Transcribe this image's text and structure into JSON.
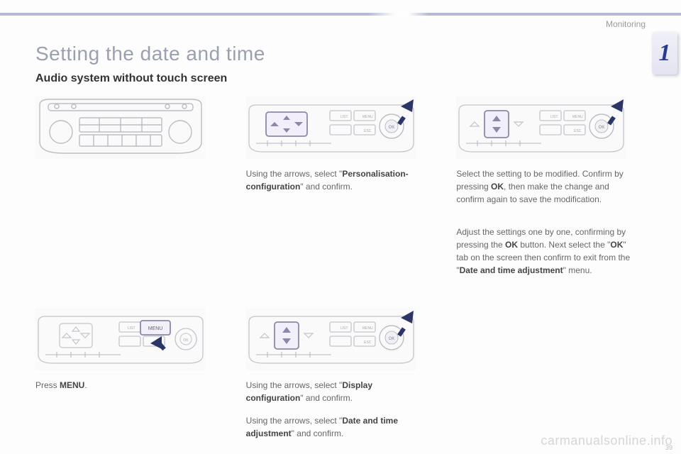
{
  "header": {
    "section": "Monitoring",
    "chapter": "1"
  },
  "title": "Setting the date and time",
  "subtitle": "Audio system without touch screen",
  "steps": {
    "s1": {
      "btn_label": "MENU",
      "caption_pre": "Press ",
      "caption_bold": "MENU",
      "caption_post": "."
    },
    "s2": {
      "caption_pre": "Using the arrows, select \"",
      "caption_bold": "Personalisation-configuration",
      "caption_post": "\" and confirm."
    },
    "s3a": {
      "caption_pre": "Using the arrows, select \"",
      "caption_bold": "Display configuration",
      "caption_post": "\" and confirm."
    },
    "s3b": {
      "caption_pre": "Using the arrows, select \"",
      "caption_bold": "Date and time adjustment",
      "caption_post": "\" and confirm."
    },
    "s4": {
      "p1a": "Select the setting to be modified. Confirm by pressing ",
      "p1b": "OK",
      "p1c": ", then make the change and confirm again to save the modification."
    },
    "s5": {
      "p2a": "Adjust the settings one by one, confirming by pressing the ",
      "p2b": "OK",
      "p2c": " button. Next select the \"",
      "p2d": "OK",
      "p2e": "\" tab on the screen then confirm to exit from the \"",
      "p2f": "Date and time adjustment",
      "p2g": "\" menu."
    }
  },
  "panel_labels": {
    "list": "LIST",
    "menu": "MENU",
    "esc": "ESC",
    "ok": "OK"
  },
  "footer": {
    "watermark": "carmanualsonline.info",
    "page": "39"
  }
}
